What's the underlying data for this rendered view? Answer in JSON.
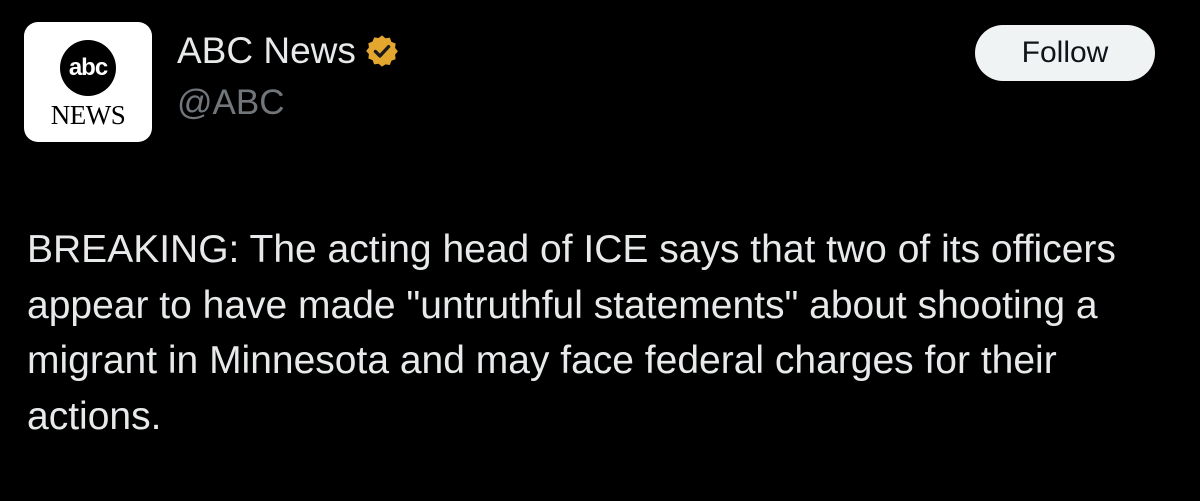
{
  "account": {
    "avatar_logo_text": "abc",
    "avatar_news_text": "NEWS",
    "display_name": "ABC News",
    "handle": "@ABC",
    "verified_badge_color": "#e3a72f",
    "verified_icon": "verified-badge-icon"
  },
  "actions": {
    "follow_label": "Follow"
  },
  "post": {
    "text": "BREAKING: The acting head of ICE says that two of its officers appear to have made \"untruthful statements\" about shooting a migrant in Minnesota and may face federal charges for their actions."
  },
  "colors": {
    "background": "#000000",
    "primary_text": "#e7e9ea",
    "secondary_text": "#71767b",
    "follow_button_bg": "#eff3f4",
    "follow_button_text": "#0f1419"
  }
}
